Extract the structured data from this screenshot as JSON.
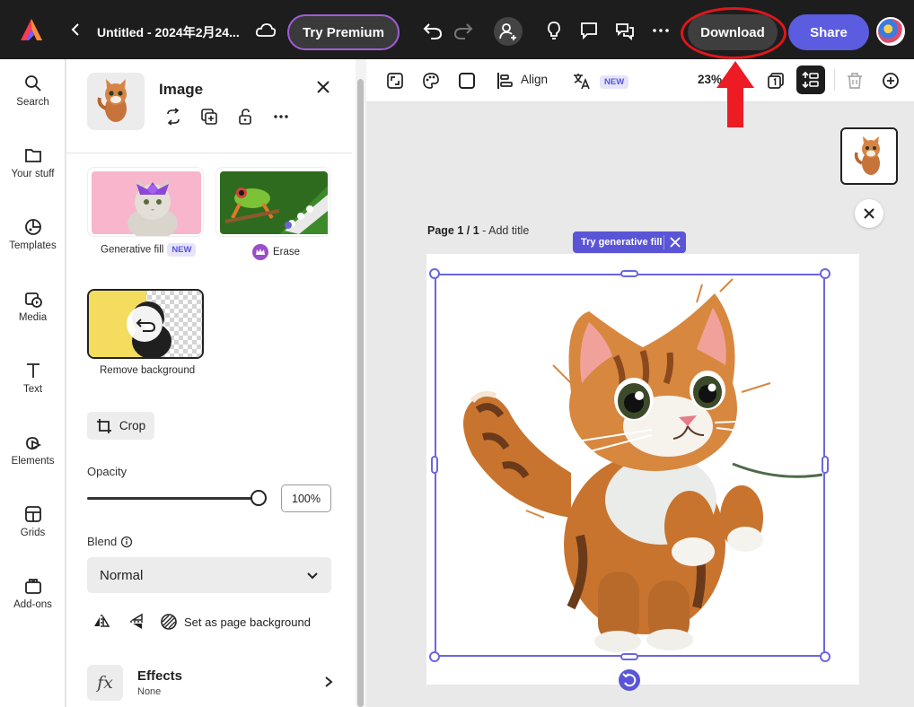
{
  "topbar": {
    "doc_title": "Untitled - 2024年2月24...",
    "premium_label": "Try Premium",
    "download_label": "Download",
    "share_label": "Share",
    "icons": [
      "logo-icon",
      "back-icon",
      "cloud-icon",
      "undo-icon",
      "redo-icon",
      "invite-icon",
      "lightbulb-icon",
      "comment-icon",
      "comments-icon",
      "more-icon"
    ]
  },
  "rail": {
    "items": [
      {
        "label": "Search",
        "icon": "search-icon"
      },
      {
        "label": "Your stuff",
        "icon": "folder-icon"
      },
      {
        "label": "Templates",
        "icon": "templates-icon"
      },
      {
        "label": "Media",
        "icon": "media-icon"
      },
      {
        "label": "Text",
        "icon": "text-icon"
      },
      {
        "label": "Elements",
        "icon": "elements-icon"
      },
      {
        "label": "Grids",
        "icon": "grids-icon"
      },
      {
        "label": "Add-ons",
        "icon": "addons-icon"
      }
    ]
  },
  "panel": {
    "title": "Image",
    "quick_actions": {
      "generative_fill": "Generative fill",
      "new_badge": "NEW",
      "erase": "Erase",
      "remove_background": "Remove background"
    },
    "crop_label": "Crop",
    "opacity_label": "Opacity",
    "opacity_value": "100%",
    "opacity_fraction": 1.0,
    "blend_label": "Blend",
    "blend_value": "Normal",
    "set_bg_label": "Set as page background",
    "effects_title": "Effects",
    "effects_sub": "None"
  },
  "canvas_toolbar": {
    "align_label": "Align",
    "new_badge": "NEW",
    "zoom": "23%"
  },
  "canvas": {
    "page_label_bold": "Page 1 / 1",
    "page_label_rest": " - Add title",
    "gen_fill_pill": "Try generative fill"
  },
  "colors": {
    "accent": "#5a55d6",
    "download_highlight": "#e0161b",
    "share": "#5c5ce0"
  }
}
